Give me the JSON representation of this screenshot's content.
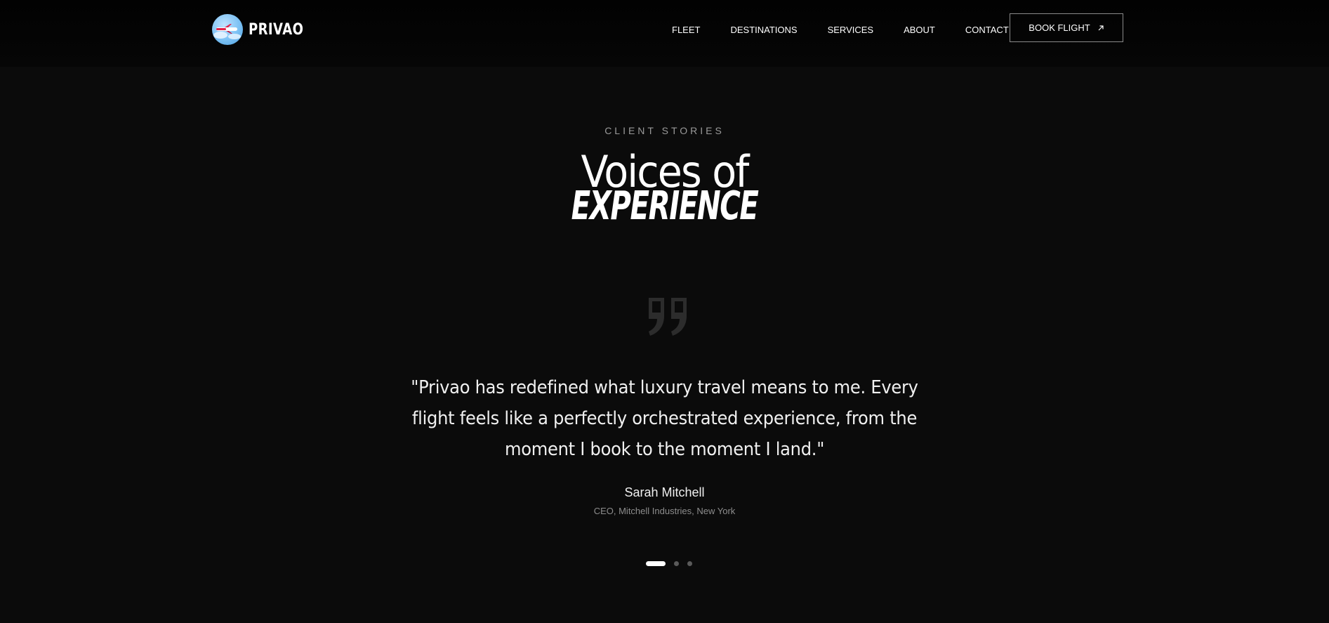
{
  "brand": {
    "name": "PRIVAO"
  },
  "nav": {
    "items": [
      "FLEET",
      "DESTINATIONS",
      "SERVICES",
      "ABOUT",
      "CONTACT"
    ],
    "cta": "BOOK FLIGHT"
  },
  "section": {
    "eyebrow": "CLIENT STORIES",
    "title_line1": "Voices of",
    "title_line2": "EXPERIENCE"
  },
  "testimonial": {
    "quote": "\"Privao has redefined what luxury travel means to me. Every flight feels like a perfectly orchestrated experience, from the moment I book to the moment I land.\"",
    "author": "Sarah Mitchell",
    "role": "CEO, Mitchell Industries, New York"
  },
  "carousel": {
    "total": 3,
    "active": 1
  },
  "colors": {
    "background": "#0b0b0b",
    "header": "#040404",
    "text": "#ffffff",
    "muted": "#8d8d8d"
  },
  "icons": [
    "logo-globe-icon",
    "arrow-up-right-icon",
    "quote-icon"
  ]
}
